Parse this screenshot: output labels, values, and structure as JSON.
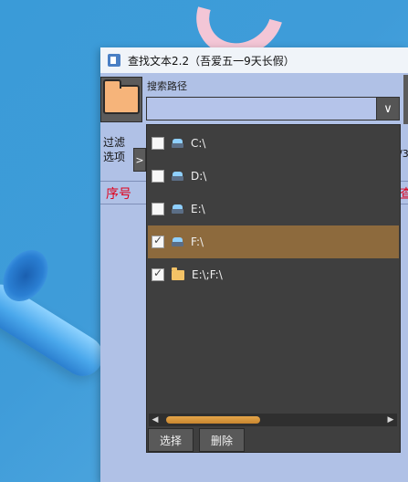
{
  "window": {
    "title": "查找文本2.2（吾爱五一9天长假）"
  },
  "toolbar": {
    "path_label": "搜索路径",
    "path_value": "",
    "combo_arrow": "∨"
  },
  "filter": {
    "label_line1": "过滤",
    "label_line2": "选项",
    "toggle": ">",
    "right_fragment": "/3"
  },
  "grid": {
    "col_seq": "序号",
    "col_right": "查"
  },
  "dropdown": {
    "items": [
      {
        "label": "C:\\",
        "checked": false,
        "icon": "drive-icon"
      },
      {
        "label": "D:\\",
        "checked": false,
        "icon": "drive-icon"
      },
      {
        "label": "E:\\",
        "checked": false,
        "icon": "drive-icon"
      },
      {
        "label": "F:\\",
        "checked": true,
        "icon": "drive-icon"
      },
      {
        "label": "E:\\;F:\\",
        "checked": true,
        "icon": "folder-icon"
      }
    ],
    "selected_index": 3,
    "scroll_position_fraction": 0.0,
    "scroll_visible_fraction": 0.43,
    "select_button": "选择",
    "delete_button": "删除"
  },
  "colors": {
    "selected_bg": "#8d6a3d",
    "dropdown_bg": "#3f3f3f",
    "header_text": "#e0001b",
    "window_bg": "#b0c1e6"
  }
}
